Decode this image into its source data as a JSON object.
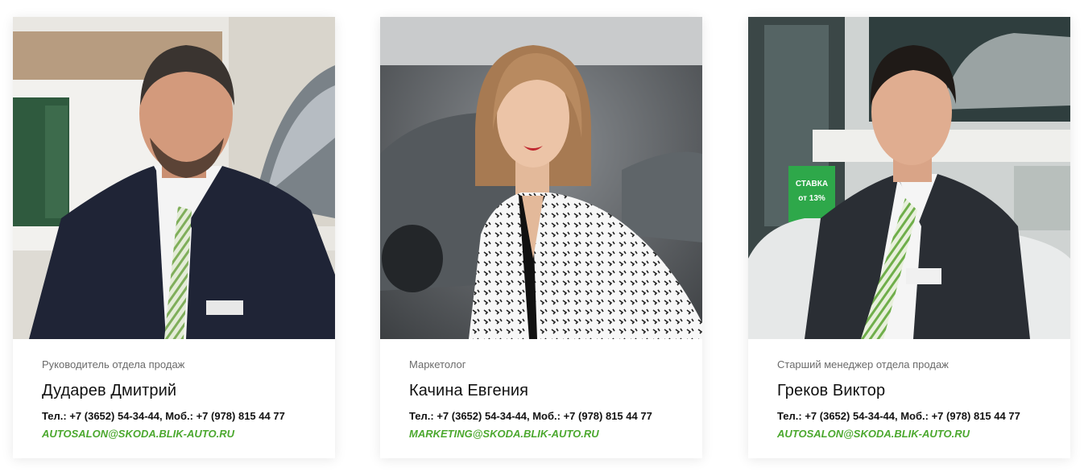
{
  "brand": {
    "accent_color": "#4ba82e"
  },
  "team": [
    {
      "position": "Руководитель отдела продаж",
      "name": "Дударев Дмитрий",
      "phones": "Тел.: +7 (3652) 54-34-44, Моб.: +7 (978) 815 44 77",
      "email": "AUTOSALON@SKODA.BLIK-AUTO.RU"
    },
    {
      "position": "Маркетолог",
      "name": "Качина Евгения",
      "phones": "Тел.: +7 (3652) 54-34-44, Моб.: +7 (978) 815 44 77",
      "email": "MARKETING@SKODA.BLIK-AUTO.RU"
    },
    {
      "position": "Старший менеджер отдела продаж",
      "name": "Греков Виктор",
      "phones": "Тел.: +7 (3652) 54-34-44, Моб.: +7 (978) 815 44 77",
      "email": "AUTOSALON@SKODA.BLIK-AUTO.RU",
      "photo_sign_text": "СТАВКА от 13%"
    }
  ]
}
